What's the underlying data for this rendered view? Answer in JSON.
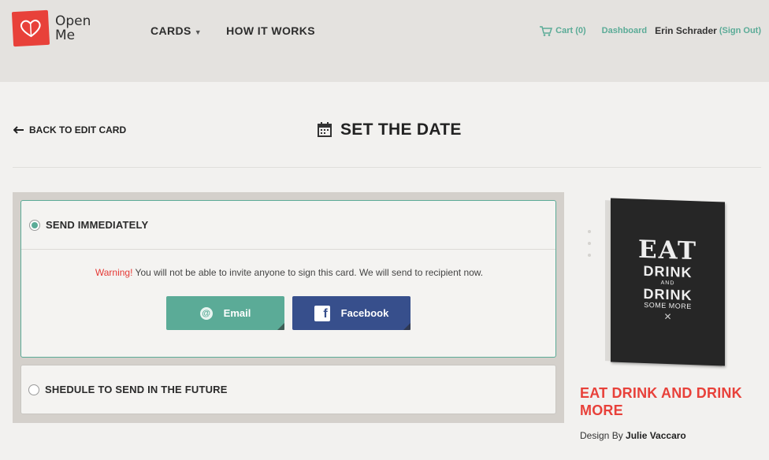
{
  "header": {
    "logo_text": "Open Me",
    "nav": [
      {
        "label": "CARDS",
        "has_dropdown": true
      },
      {
        "label": "HOW IT WORKS",
        "has_dropdown": false
      }
    ],
    "cart_label": "Cart (0)",
    "dashboard_label": "Dashboard",
    "user_name": "Erin Schrader",
    "sign_out_label": "(Sign Out)"
  },
  "page": {
    "back_label": "BACK TO EDIT CARD",
    "title": "SET THE DATE"
  },
  "options": {
    "send_now": {
      "label": "SEND IMMEDIATELY",
      "selected": true,
      "warning_prefix": "Warning!",
      "warning_text": " You will not be able to invite anyone to sign this card. We will send to recipient now.",
      "email_button": "Email",
      "facebook_button": "Facebook"
    },
    "schedule": {
      "label": "SHEDULE TO SEND IN THE FUTURE",
      "selected": false
    }
  },
  "card": {
    "art": {
      "line1": "EAT",
      "line2": "DRINK",
      "line3": "AND",
      "line4": "DRINK",
      "line5": "SOME MORE"
    },
    "title": "EAT DRINK AND DRINK MORE",
    "design_by_prefix": "Design By ",
    "designer": "Julie Vaccaro"
  },
  "colors": {
    "accent": "#5bab97",
    "brand_red": "#e8413a",
    "facebook": "#374f8c"
  }
}
